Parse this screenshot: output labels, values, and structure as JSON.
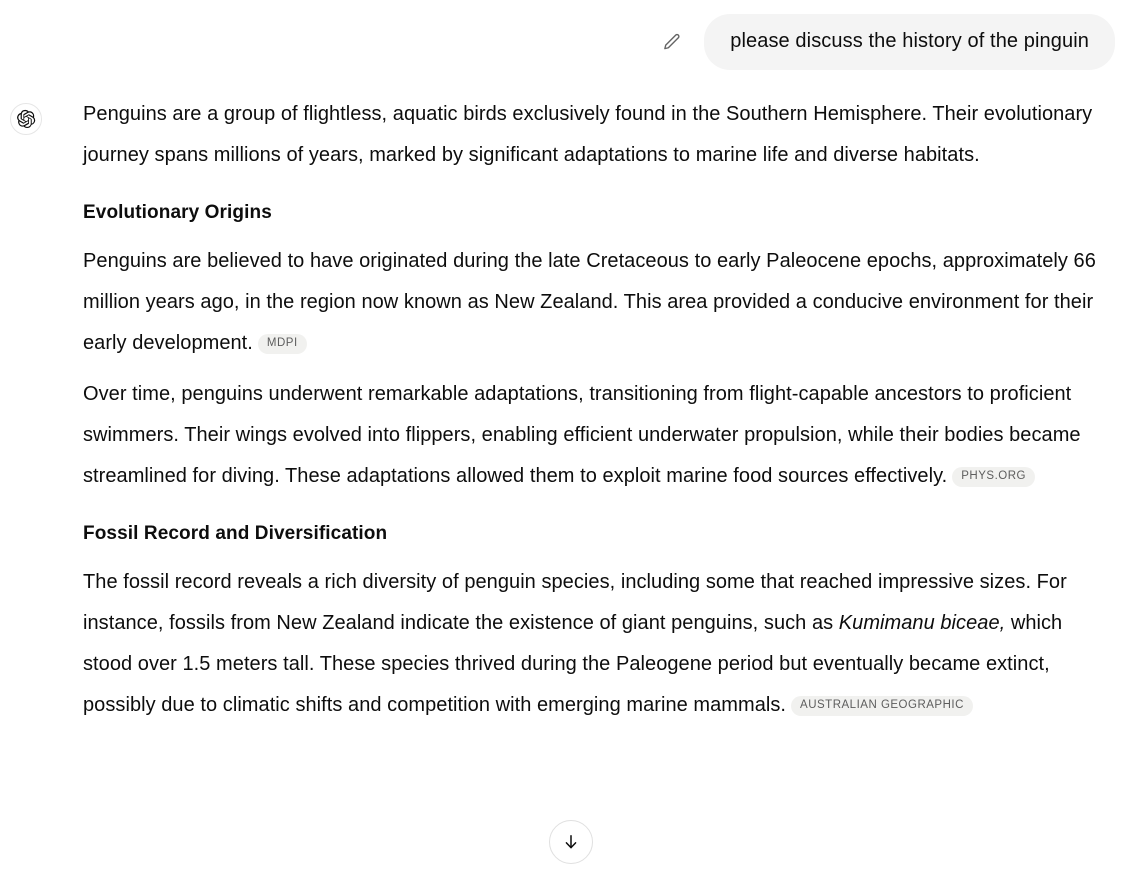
{
  "user_turn": {
    "edit_icon": "pencil-icon",
    "message": "please discuss the history of the pinguin"
  },
  "assistant_turn": {
    "avatar_icon": "openai-logo-icon",
    "paragraph_1": "Penguins are a group of flightless, aquatic birds exclusively found in the Southern Hemisphere. Their evolutionary journey spans millions of years, marked by significant adaptations to marine life and diverse habitats.",
    "heading_1": "Evolutionary Origins",
    "paragraph_2": "Penguins are believed to have originated during the late Cretaceous to early Paleocene epochs, approximately 66 million years ago, in the region now known as New Zealand. This area provided a conducive environment for their early development.",
    "citation_1": "MDPI",
    "paragraph_3": "Over time, penguins underwent remarkable adaptations, transitioning from flight-capable ancestors to proficient swimmers. Their wings evolved into flippers, enabling efficient underwater propulsion, while their bodies became streamlined for diving. These adaptations allowed them to exploit marine food sources effectively.",
    "citation_2": "PHYS.ORG",
    "heading_2": "Fossil Record and Diversification",
    "paragraph_4a": "The fossil record reveals a rich diversity of penguin species, including some that reached impressive sizes. For instance, fossils from New Zealand indicate the existence of giant penguins, such as ",
    "paragraph_4_species": "Kumimanu biceae,",
    "paragraph_4b": " which stood over 1.5 meters tall. These species thrived during the Paleogene period but eventually became extinct, possibly due to climatic shifts and competition with emerging marine mammals.",
    "citation_3": "AUSTRALIAN GEOGRAPHIC"
  },
  "controls": {
    "scroll_to_bottom_icon": "arrow-down-icon"
  },
  "colors": {
    "page_background": "#ffffff",
    "user_bubble_background": "#f4f4f4",
    "citation_background": "#f1f1ef",
    "citation_text": "#5d5d5d",
    "body_text": "#0d0d0d"
  }
}
